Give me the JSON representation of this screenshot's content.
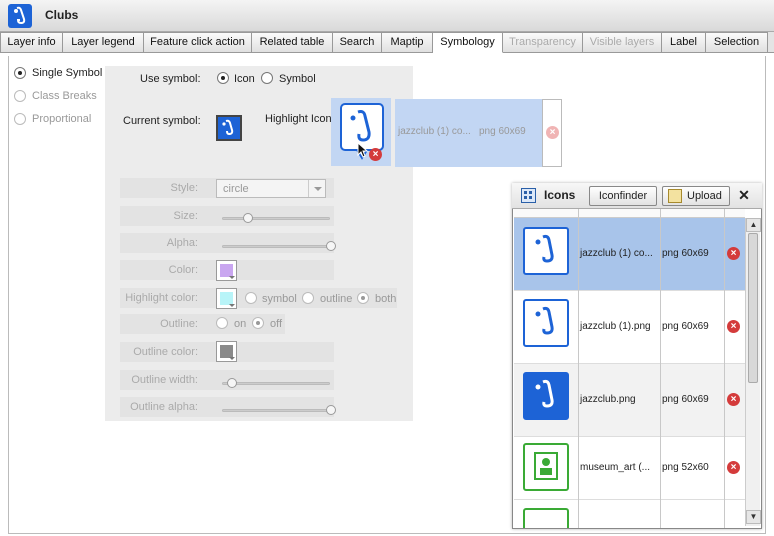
{
  "window": {
    "title": "Clubs"
  },
  "tabs": [
    {
      "label": "Layer info",
      "state": "normal"
    },
    {
      "label": "Layer legend",
      "state": "normal"
    },
    {
      "label": "Feature click action",
      "state": "normal"
    },
    {
      "label": "Related table",
      "state": "normal"
    },
    {
      "label": "Search",
      "state": "normal"
    },
    {
      "label": "Maptip",
      "state": "normal"
    },
    {
      "label": "Symbology",
      "state": "active"
    },
    {
      "label": "Transparency",
      "state": "disabled"
    },
    {
      "label": "Visible layers",
      "state": "disabled"
    },
    {
      "label": "Label",
      "state": "normal"
    },
    {
      "label": "Selection",
      "state": "normal"
    }
  ],
  "symbology_types": [
    {
      "label": "Single Symbol",
      "selected": true
    },
    {
      "label": "Class Breaks",
      "selected": false
    },
    {
      "label": "Proportional",
      "selected": false
    }
  ],
  "use_symbol": {
    "label": "Use symbol:",
    "options": [
      {
        "label": "Icon",
        "selected": true
      },
      {
        "label": "Symbol",
        "selected": false
      }
    ]
  },
  "current_symbol": {
    "label": "Current symbol:",
    "icon": "saxophone-icon"
  },
  "highlight_icon": {
    "label": "Highlight Icon",
    "filename": "jazzclub (1) co...",
    "format": "png 60x69"
  },
  "settings": {
    "style": {
      "label": "Style:",
      "value": "circle"
    },
    "size": {
      "label": "Size:",
      "fraction": 0.25
    },
    "alpha": {
      "label": "Alpha:",
      "fraction": 1.0
    },
    "color": {
      "label": "Color:",
      "value": "#c9a6f0"
    },
    "highlight_color": {
      "label": "Highlight color:",
      "value": "#b8f4f8",
      "options": [
        {
          "label": "symbol",
          "selected": false
        },
        {
          "label": "outline",
          "selected": false
        },
        {
          "label": "both",
          "selected": true
        }
      ]
    },
    "outline": {
      "label": "Outline:",
      "options": [
        {
          "label": "on",
          "selected": false
        },
        {
          "label": "off",
          "selected": true
        }
      ]
    },
    "outline_color": {
      "label": "Outline color:",
      "value": "#8a8a8a"
    },
    "outline_width": {
      "label": "Outline width:",
      "fraction": 0.05
    },
    "outline_alpha": {
      "label": "Outline alpha:",
      "fraction": 1.0
    }
  },
  "icons_dialog": {
    "title": "Icons",
    "iconfinder_label": "Iconfinder",
    "upload_label": "Upload",
    "close_label": "✕",
    "items": [
      {
        "name": "jazzclub (1) co...",
        "type": "png 60x69",
        "icon": "saxophone-marker-icon",
        "selected": true
      },
      {
        "name": "jazzclub (1).png",
        "type": "png 60x69",
        "icon": "saxophone-marker-icon",
        "selected": false
      },
      {
        "name": "jazzclub.png",
        "type": "png 60x69",
        "icon": "saxophone-marker-dark-icon",
        "selected": false
      },
      {
        "name": "museum_art (...",
        "type": "png 52x60",
        "icon": "museum-marker-icon",
        "selected": false
      }
    ]
  },
  "colors": {
    "accent": "#1d63d6",
    "selection": "#a8c4ea",
    "delete": "#d43b3b",
    "museum_green": "#3aaa35"
  }
}
